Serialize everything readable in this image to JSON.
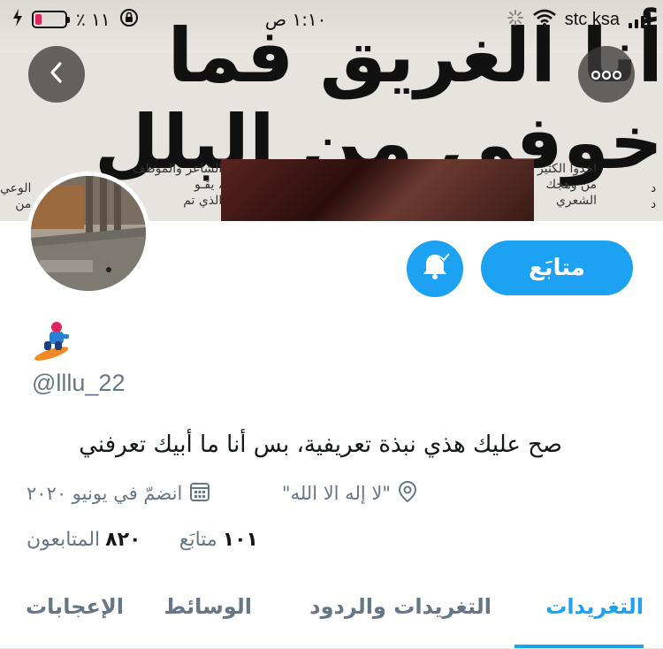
{
  "status_bar": {
    "carrier": "stc ksa",
    "time": "١:١٠ ص",
    "battery_percent": "١١ ٪",
    "battery_level": 0.22
  },
  "banner": {
    "headline": "أنا الغريق فما خوفي من البلل",
    "col_a": [
      "الشاعر والموظف",
      "، يقـو",
      "الذي تم"
    ],
    "col_b": [
      "اخذوا الكثير",
      "من وهجك",
      "الشعري"
    ],
    "col_c": [
      "الوعي",
      "من"
    ],
    "col_d": [
      "د",
      "د"
    ]
  },
  "profile": {
    "follow_label": "متابَع",
    "handle": "@lllu_22",
    "bio": "صح عليك هذي نبذة تعريفية، بس أنا ما أبيك تعرفني",
    "location": "\"لا إله الا الله\"",
    "joined": "انضمّ في يونيو ٢٠٢٠",
    "following_count": "١٠١",
    "following_label": "متابَع",
    "followers_count": "٨٢٠",
    "followers_label": "المتابعون"
  },
  "tabs": [
    {
      "label": "التغريدات",
      "active": true
    },
    {
      "label": "التغريدات والردود",
      "active": false
    },
    {
      "label": "الوسائط",
      "active": false
    },
    {
      "label": "الإعجابات",
      "active": false
    }
  ],
  "colors": {
    "accent": "#1da1f2",
    "muted": "#657786",
    "text": "#14171a"
  },
  "icons": [
    "back-arrow-icon",
    "more-icon",
    "bell-icon",
    "location-pin-icon",
    "calendar-icon",
    "wifi-icon",
    "signal-icon",
    "battery-icon",
    "orientation-lock-icon",
    "charging-icon"
  ]
}
